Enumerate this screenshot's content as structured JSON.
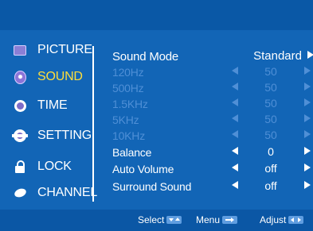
{
  "sidebar": {
    "items": [
      {
        "label": "PICTURE",
        "icon": "picture-icon"
      },
      {
        "label": "SOUND",
        "icon": "sound-icon",
        "active": true
      },
      {
        "label": "TIME",
        "icon": "clock-icon"
      },
      {
        "label": "SETTING",
        "icon": "gear-icon"
      },
      {
        "label": "LOCK",
        "icon": "lock-icon"
      },
      {
        "label": "CHANNEL",
        "icon": "channel-icon"
      }
    ]
  },
  "sound_menu": {
    "mode": {
      "label": "Sound Mode",
      "value": "Standard"
    },
    "eq": [
      {
        "label": "120Hz",
        "value": "50"
      },
      {
        "label": "500Hz",
        "value": "50"
      },
      {
        "label": "1.5KHz",
        "value": "50"
      },
      {
        "label": "5KHz",
        "value": "50"
      },
      {
        "label": "10KHz",
        "value": "50"
      }
    ],
    "balance": {
      "label": "Balance",
      "value": "0"
    },
    "auto_volume": {
      "label": "Auto Volume",
      "value": "off"
    },
    "surround": {
      "label": "Surround Sound",
      "value": "off"
    }
  },
  "footer": {
    "select": "Select",
    "menu": "Menu",
    "adjust": "Adjust"
  },
  "colors": {
    "background": "#0d63b8",
    "active_text": "#ffde3a",
    "disabled_text": "#4f8fd6",
    "text": "#ffffff"
  }
}
